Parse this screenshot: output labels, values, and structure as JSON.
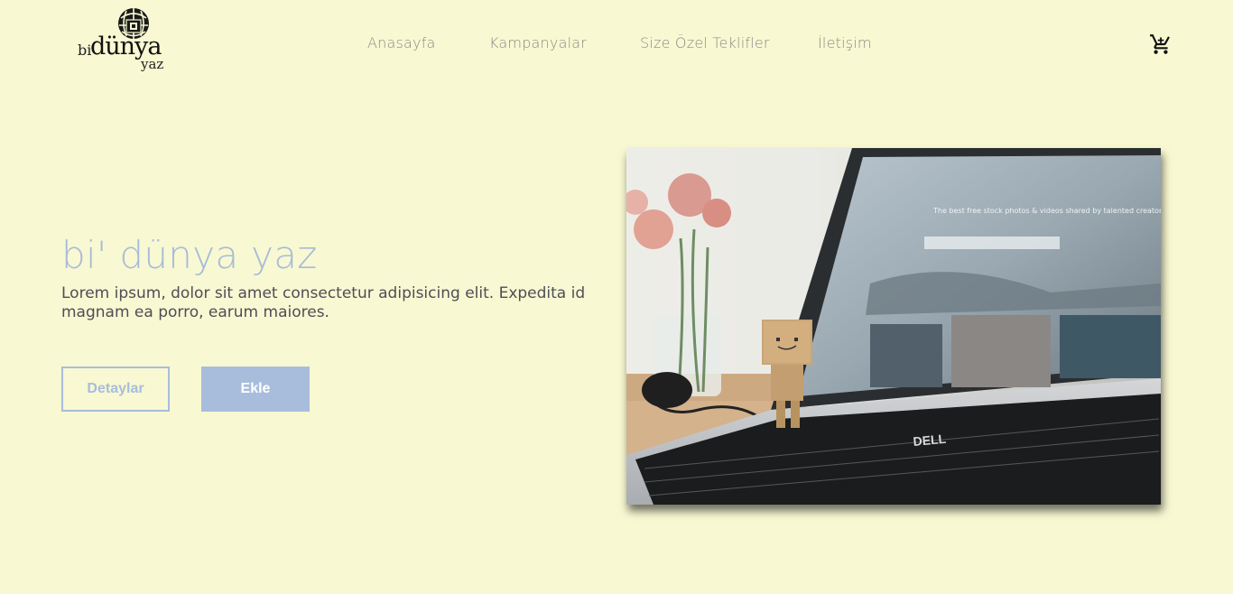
{
  "brand": {
    "bi": "bi",
    "dunya": "dünya",
    "yaz": "yaz"
  },
  "nav": {
    "items": [
      {
        "label": "Anasayfa"
      },
      {
        "label": "Kampanyalar"
      },
      {
        "label": "Size Özel Teklifler"
      },
      {
        "label": "İletişim"
      }
    ],
    "cart_icon": "shopping-cart-icon"
  },
  "hero": {
    "title": "bi' dünya yaz",
    "description": "Lorem ipsum, dolor sit amet consectetur adipisicing elit. Expedita id magnam ea porro, earum maiores.",
    "details_label": "Detaylar",
    "add_label": "Ekle"
  },
  "image": {
    "screen_headline": "The best free stock photos & videos shared by talented creators.",
    "laptop_brand": "DELL"
  },
  "colors": {
    "background": "#f8f8d2",
    "accent": "#a8bddc",
    "nav_text": "#8a8a8a",
    "body_text": "#4e4e57"
  }
}
